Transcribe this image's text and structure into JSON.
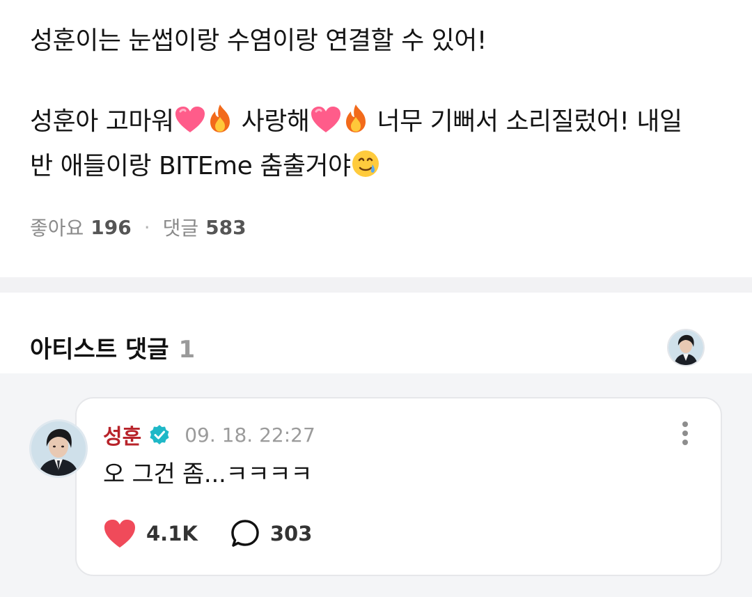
{
  "post": {
    "lines": [
      "성훈이는 눈썹이랑 수염이랑 연결할 수 있어!",
      "성훈아 고마워",
      "사랑해",
      "너무 기뻐서 소리질렀어! 내일",
      "반 애들이랑 BITEme 춤출거야"
    ],
    "stats": {
      "likes_label": "좋아요",
      "likes_count": "196",
      "separator": "·",
      "comments_label": "댓글",
      "comments_count": "583"
    }
  },
  "artist_comments": {
    "title": "아티스트 댓글",
    "count": "1"
  },
  "comment": {
    "author": "성훈",
    "time": "09. 18. 22:27",
    "text": "오 그건 좀...ㅋㅋㅋㅋ",
    "like_count": "4.1K",
    "reply_count": "303"
  },
  "colors": {
    "author": "#b8232a",
    "heart": "#f04a5a",
    "verified": "#1fb8c7",
    "divider": "#f2f2f4",
    "comment_bg": "#f4f5f7"
  },
  "icons": [
    "heart-emoji",
    "fire-emoji",
    "tear-smile-emoji",
    "verified-icon",
    "more-icon",
    "heart-icon",
    "reply-bubble-icon"
  ]
}
